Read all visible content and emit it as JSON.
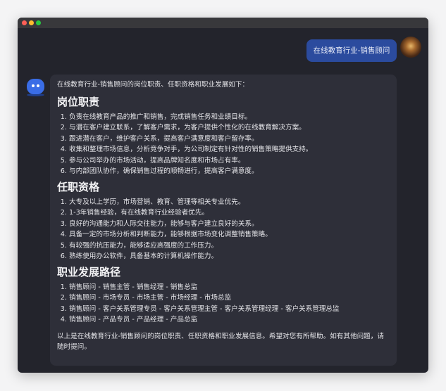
{
  "window": {
    "controls": [
      "close",
      "minimize",
      "maximize"
    ]
  },
  "user_message": "在线教育行业-销售顾问",
  "bot_message": {
    "intro": "在线教育行业-销售顾问的岗位职责、任职资格和职业发展如下：",
    "sections": [
      {
        "title": "岗位职责",
        "items": [
          "负责在线教育产品的推广和销售，完成销售任务和业绩目标。",
          "与潜在客户建立联系，了解客户需求，为客户提供个性化的在线教育解决方案。",
          "跟进潜在客户，维护客户关系，提高客户满意度和客户留存率。",
          "收集和整理市场信息，分析竞争对手，为公司制定有针对性的销售策略提供支持。",
          "参与公司举办的市场活动，提高品牌知名度和市场占有率。",
          "与内部团队协作，确保销售过程的顺畅进行，提高客户满意度。"
        ]
      },
      {
        "title": "任职资格",
        "items": [
          "大专及以上学历，市场营销、教育、管理等相关专业优先。",
          "1-3年销售经验，有在线教育行业经验者优先。",
          "良好的沟通能力和人际交往能力，能够与客户建立良好的关系。",
          "具备一定的市场分析和判断能力，能够根据市场变化调整销售策略。",
          "有较强的抗压能力，能够适应高强度的工作压力。",
          "熟练使用办公软件，具备基本的计算机操作能力。"
        ]
      },
      {
        "title": "职业发展路径",
        "items": [
          "销售顾问 - 销售主管 - 销售经理 - 销售总监",
          "销售顾问 - 市场专员 - 市场主管 - 市场经理 - 市场总监",
          "销售顾问 - 客户关系管理专员 - 客户关系管理主管 - 客户关系管理经理 - 客户关系管理总监",
          "销售顾问 - 产品专员 - 产品经理 - 产品总监"
        ]
      }
    ],
    "outro": "以上是在线教育行业-销售顾问的岗位职责、任职资格和职业发展信息。希望对您有所帮助。如有其他问题，请随时提问。"
  },
  "colors": {
    "user_bubble": "#2b4b9e",
    "bot_bubble": "#2e2f39",
    "background": "#23242c"
  }
}
